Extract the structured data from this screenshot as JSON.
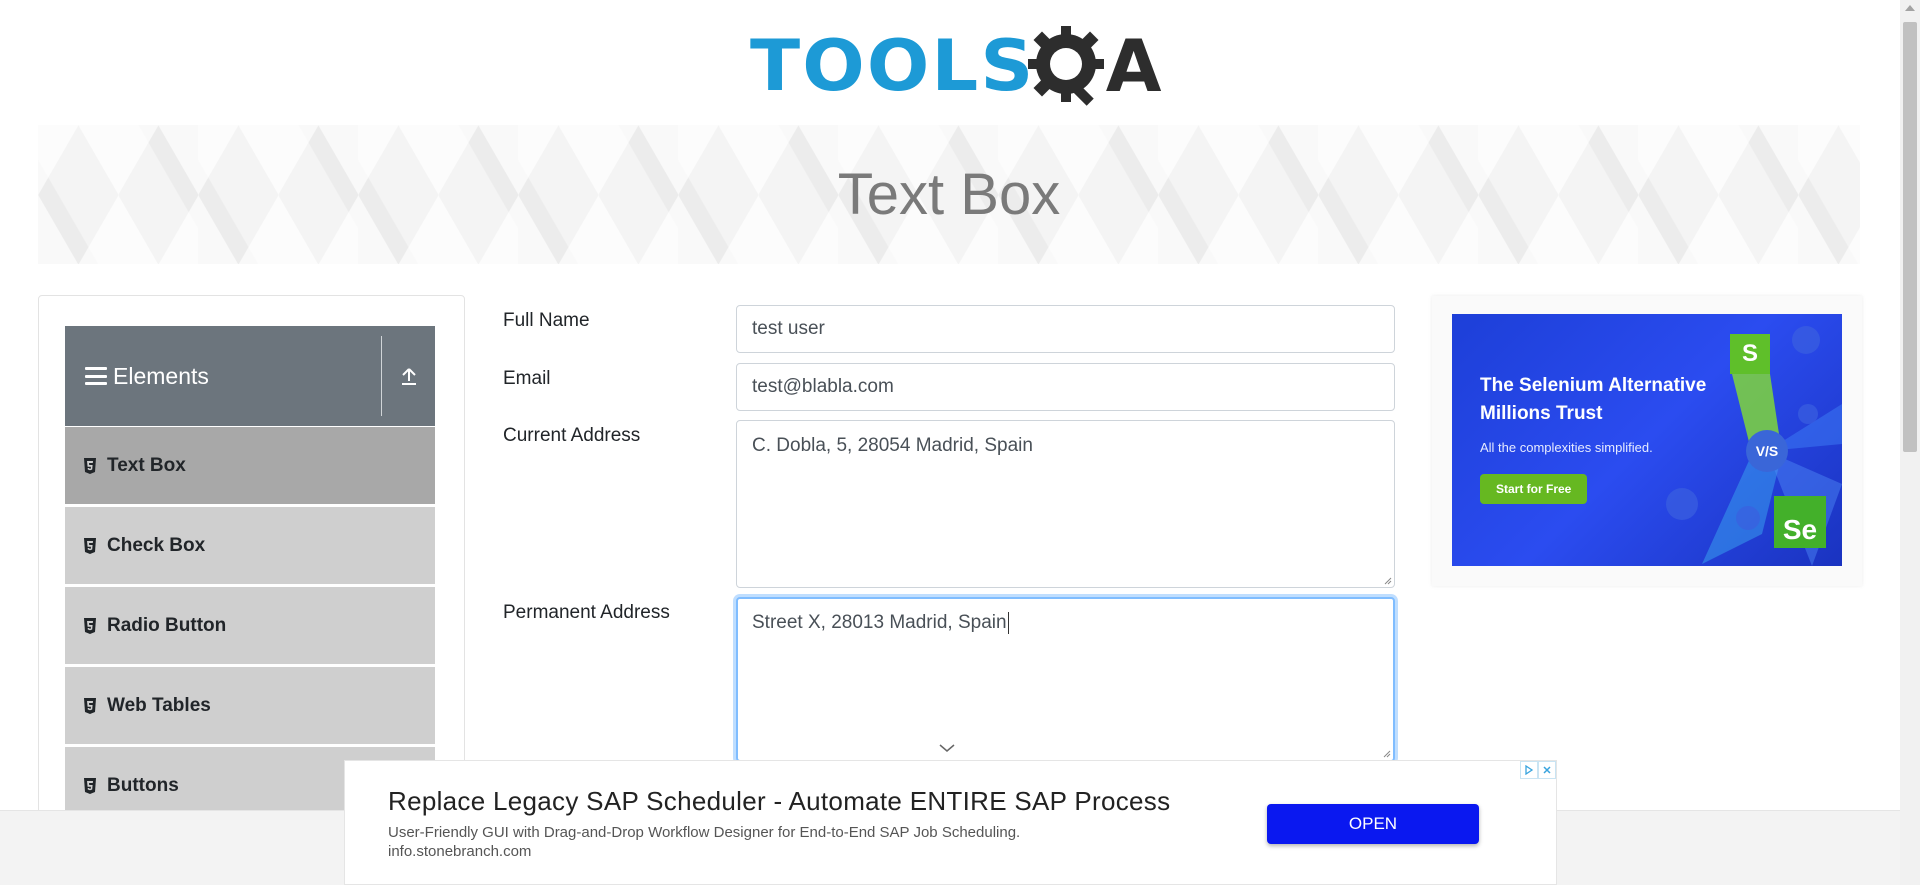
{
  "header": {
    "logo_text_left": "TOOLS",
    "logo_text_right": "A"
  },
  "banner": {
    "title": "Text Box"
  },
  "sidebar": {
    "group_title": "Elements",
    "items": [
      {
        "label": "Text Box",
        "active": true
      },
      {
        "label": "Check Box"
      },
      {
        "label": "Radio Button"
      },
      {
        "label": "Web Tables"
      },
      {
        "label": "Buttons"
      }
    ]
  },
  "form": {
    "full_name": {
      "label": "Full Name",
      "value": "test user"
    },
    "email": {
      "label": "Email",
      "value": "test@blabla.com"
    },
    "current_address": {
      "label": "Current Address",
      "value": "C. Dobla, 5, 28054 Madrid, Spain"
    },
    "permanent_address": {
      "label": "Permanent Address",
      "value": "Street X, 28013 Madrid, Spain"
    }
  },
  "side_ad": {
    "headline": "The Selenium Alternative Millions Trust",
    "subline": "All the complexities simplified.",
    "cta": "Start for Free",
    "badge_s": "S",
    "badge_se": "Se",
    "badge_vs": "V/S"
  },
  "bottom_ad": {
    "title": "Replace Legacy SAP Scheduler - Automate ENTIRE SAP Process",
    "description": "User-Friendly GUI with Drag-and-Drop Workflow Designer for End-to-End SAP Job Scheduling.",
    "url": "info.stonebranch.com",
    "button": "OPEN"
  },
  "colors": {
    "brand_blue": "#1d9ad6",
    "sidebar_header": "#6c757d",
    "ad_button": "#0a18f0"
  }
}
